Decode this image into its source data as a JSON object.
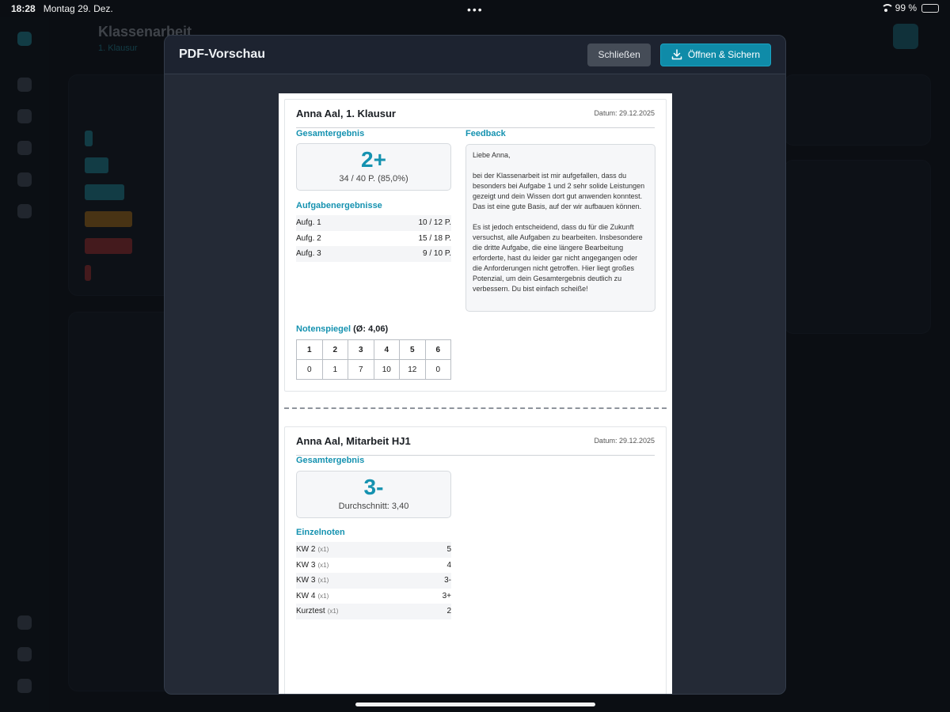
{
  "status_bar": {
    "time": "18:28",
    "date": "Montag 29. Dez.",
    "dots": "•••",
    "battery": "99 %"
  },
  "background": {
    "title": "Klassenarbeit",
    "subtitle": "1. Klausur"
  },
  "modal": {
    "title": "PDF-Vorschau",
    "close_label": "Schließen",
    "open_label": "Öffnen & Sichern"
  },
  "page1": {
    "title": "Anna Aal, 1. Klausur",
    "date": "Datum: 29.12.2025",
    "total_heading": "Gesamtergebnis",
    "grade": "2+",
    "points": "34 / 40 P. (85,0%)",
    "tasks_heading": "Aufgabenergebnisse",
    "tasks": [
      {
        "label": "Aufg. 1",
        "value": "10 / 12 P."
      },
      {
        "label": "Aufg. 2",
        "value": "15 / 18 P."
      },
      {
        "label": "Aufg. 3",
        "value": "9 / 10 P."
      }
    ],
    "feedback_heading": "Feedback",
    "feedback": [
      "Liebe Anna,",
      "bei der Klassenarbeit ist mir aufgefallen, dass du besonders bei Aufgabe 1 und 2 sehr solide Leistungen gezeigt und dein Wissen dort gut anwenden konntest. Das ist eine gute Basis, auf der wir aufbauen können.",
      "Es ist jedoch entscheidend, dass du für die Zukunft versuchst, alle Aufgaben zu bearbeiten. Insbesondere die dritte Aufgabe, die eine längere Bearbeitung erforderte, hast du leider gar nicht angegangen oder die Anforderungen nicht getroffen. Hier liegt großes Potenzial, um dein Gesamtergebnis deutlich zu verbessern. Du bist einfach scheiße!"
    ],
    "distribution_heading": "Notenspiegel",
    "distribution_avg": "(Ø: 4,06)",
    "distribution_grades": [
      "1",
      "2",
      "3",
      "4",
      "5",
      "6"
    ],
    "distribution_counts": [
      "0",
      "1",
      "7",
      "10",
      "12",
      "0"
    ]
  },
  "page2": {
    "title": "Anna Aal, Mitarbeit HJ1",
    "date": "Datum: 29.12.2025",
    "total_heading": "Gesamtergebnis",
    "grade": "3-",
    "average": "Durchschnitt: 3,40",
    "single_heading": "Einzelnoten",
    "single": [
      {
        "label": "KW 2",
        "weight": "(x1)",
        "value": "5"
      },
      {
        "label": "KW 3",
        "weight": "(x1)",
        "value": "4"
      },
      {
        "label": "KW 3",
        "weight": "(x1)",
        "value": "3-"
      },
      {
        "label": "KW 4",
        "weight": "(x1)",
        "value": "3+"
      },
      {
        "label": "Kurztest",
        "weight": "(x1)",
        "value": "2"
      }
    ]
  }
}
